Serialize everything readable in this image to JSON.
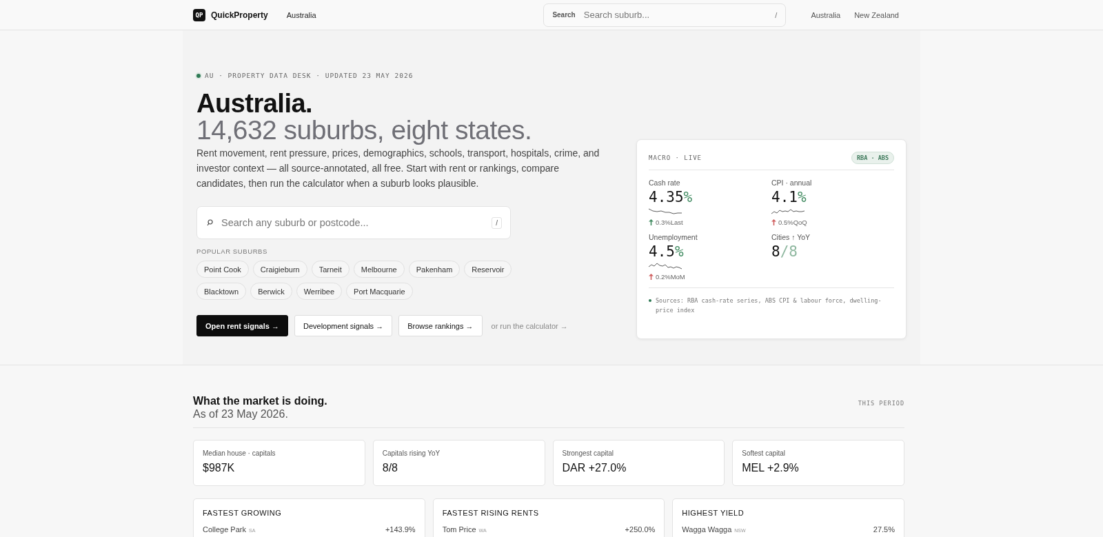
{
  "header": {
    "logo_mark": "QP",
    "brand": "QuickProperty",
    "region": "Australia",
    "search": {
      "label": "Search",
      "placeholder": "Search suburb...",
      "shortcut": "/"
    },
    "nav": [
      {
        "label": "Australia"
      },
      {
        "label": "New Zealand"
      }
    ]
  },
  "hero": {
    "eyebrow": "AU · PROPERTY DATA DESK · UPDATED 23 MAY 2026",
    "title": "Australia.",
    "subtitle": "14,632 suburbs, eight states.",
    "description": "Rent movement, rent pressure, prices, demographics, schools, transport, hospitals, crime, and investor context — all source-annotated, all free. Start with rent or rankings, compare candidates, then run the calculator when a suburb looks plausible.",
    "search": {
      "placeholder": "Search any suburb or postcode...",
      "shortcut": "/"
    },
    "popular_label": "POPULAR SUBURBS",
    "popular_suburbs": [
      "Point Cook",
      "Craigieburn",
      "Tarneit",
      "Melbourne",
      "Pakenham",
      "Reservoir",
      "Blacktown",
      "Berwick",
      "Werribee",
      "Port Macquarie"
    ],
    "actions": [
      {
        "label": "Open rent signals →",
        "kind": "primary"
      },
      {
        "label": "Development signals →",
        "kind": "secondary"
      },
      {
        "label": "Browse rankings →",
        "kind": "secondary"
      },
      {
        "label": "or run the calculator →",
        "kind": "link"
      }
    ]
  },
  "macro": {
    "title": "MACRO · LIVE",
    "badge": "RBA · ABS",
    "metrics": [
      {
        "label": "Cash rate",
        "value": "4.35",
        "unit": "%",
        "kind": "sparkline",
        "change": "0.3%Last",
        "color": "#3f8a5f"
      },
      {
        "label": "CPI · annual",
        "value": "4.1",
        "unit": "%",
        "kind": "sparkline",
        "change": "0.5%QoQ",
        "color": "#d06060"
      },
      {
        "label": "Unemployment",
        "value": "4.5",
        "unit": "%",
        "kind": "sparkline",
        "change": "0.2%MoM",
        "color": "#d06060"
      },
      {
        "label": "Cities ↑ YoY",
        "value": "8",
        "unit": "/8",
        "kind": "ratio"
      }
    ],
    "sources": "Sources: RBA cash-rate series, ABS CPI & labour force, dwelling-price index"
  },
  "market": {
    "title": "What the market is doing.",
    "subtitle": "As of 23 May 2026.",
    "period": "THIS PERIOD",
    "stats": [
      {
        "label": "Median house · capitals",
        "value": "$987K"
      },
      {
        "label": "Capitals rising YoY",
        "value": "8/8"
      },
      {
        "label": "Strongest capital",
        "value": "DAR +27.0%"
      },
      {
        "label": "Softest capital",
        "value": "MEL +2.9%"
      }
    ],
    "lists": [
      {
        "title": "FASTEST GROWING",
        "rows": [
          {
            "name": "College Park",
            "state": "SA",
            "value": "+143.9%"
          }
        ]
      },
      {
        "title": "FASTEST RISING RENTS",
        "rows": [
          {
            "name": "Tom Price",
            "state": "WA",
            "value": "+250.0%"
          }
        ]
      },
      {
        "title": "HIGHEST YIELD",
        "rows": [
          {
            "name": "Wagga Wagga",
            "state": "NSW",
            "value": "27.5%"
          }
        ]
      }
    ]
  }
}
